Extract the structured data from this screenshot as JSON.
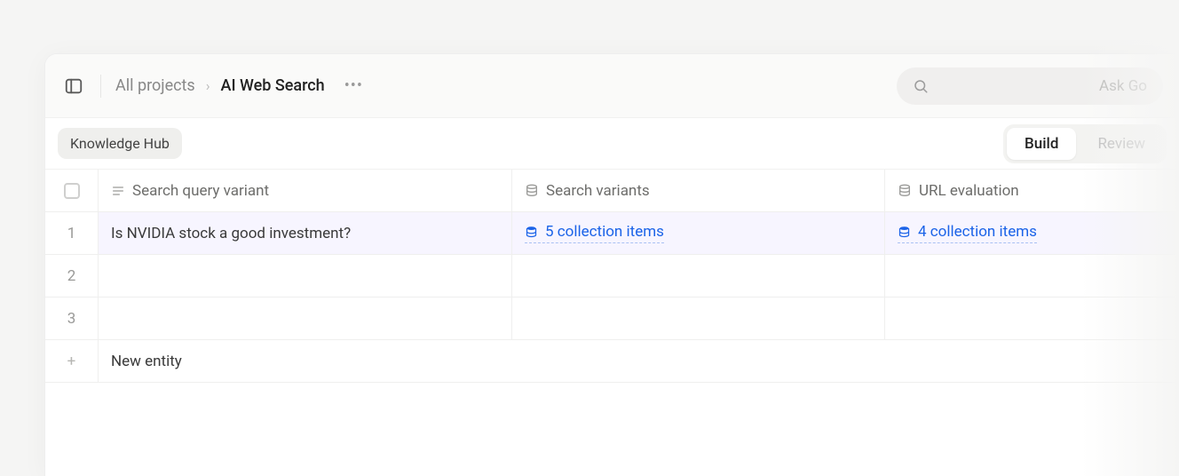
{
  "breadcrumbs": {
    "root": "All projects",
    "current": "AI Web Search"
  },
  "search": {
    "placeholder": "Ask Go"
  },
  "subheader": {
    "pill": "Knowledge Hub",
    "segment": {
      "build": "Build",
      "review": "Review"
    }
  },
  "columns": {
    "query": "Search query variant",
    "variants": "Search variants",
    "url_eval": "URL evaluation"
  },
  "rows": [
    {
      "num": "1",
      "query": "Is NVIDIA stock a good investment?",
      "variants_label": "5 collection items",
      "url_eval_label": "4 collection items"
    },
    {
      "num": "2",
      "query": "",
      "variants_label": "",
      "url_eval_label": ""
    },
    {
      "num": "3",
      "query": "",
      "variants_label": "",
      "url_eval_label": ""
    }
  ],
  "new_entity": "New entity"
}
